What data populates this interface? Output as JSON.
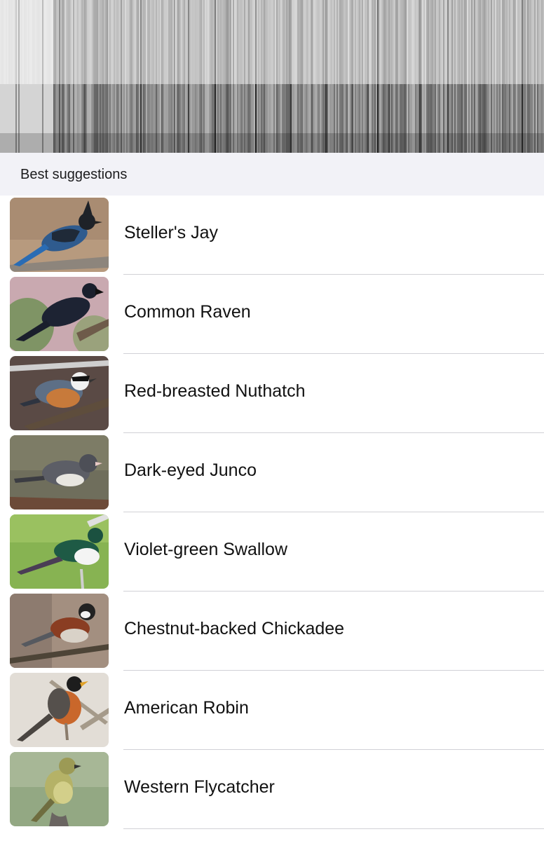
{
  "section": {
    "title": "Best suggestions"
  },
  "suggestions": [
    {
      "name": "Steller's Jay",
      "icon": "stellers-jay-photo"
    },
    {
      "name": "Common Raven",
      "icon": "common-raven-photo"
    },
    {
      "name": "Red-breasted Nuthatch",
      "icon": "red-breasted-nuthatch-photo"
    },
    {
      "name": "Dark-eyed Junco",
      "icon": "dark-eyed-junco-photo"
    },
    {
      "name": "Violet-green Swallow",
      "icon": "violet-green-swallow-photo"
    },
    {
      "name": "Chestnut-backed Chickadee",
      "icon": "chestnut-backed-chickadee-photo"
    },
    {
      "name": "American Robin",
      "icon": "american-robin-photo"
    },
    {
      "name": "Western Flycatcher",
      "icon": "western-flycatcher-photo"
    }
  ],
  "colors": {
    "header_background": "#f2f2f7",
    "separator": "#d1d1d6",
    "text": "#111111"
  }
}
